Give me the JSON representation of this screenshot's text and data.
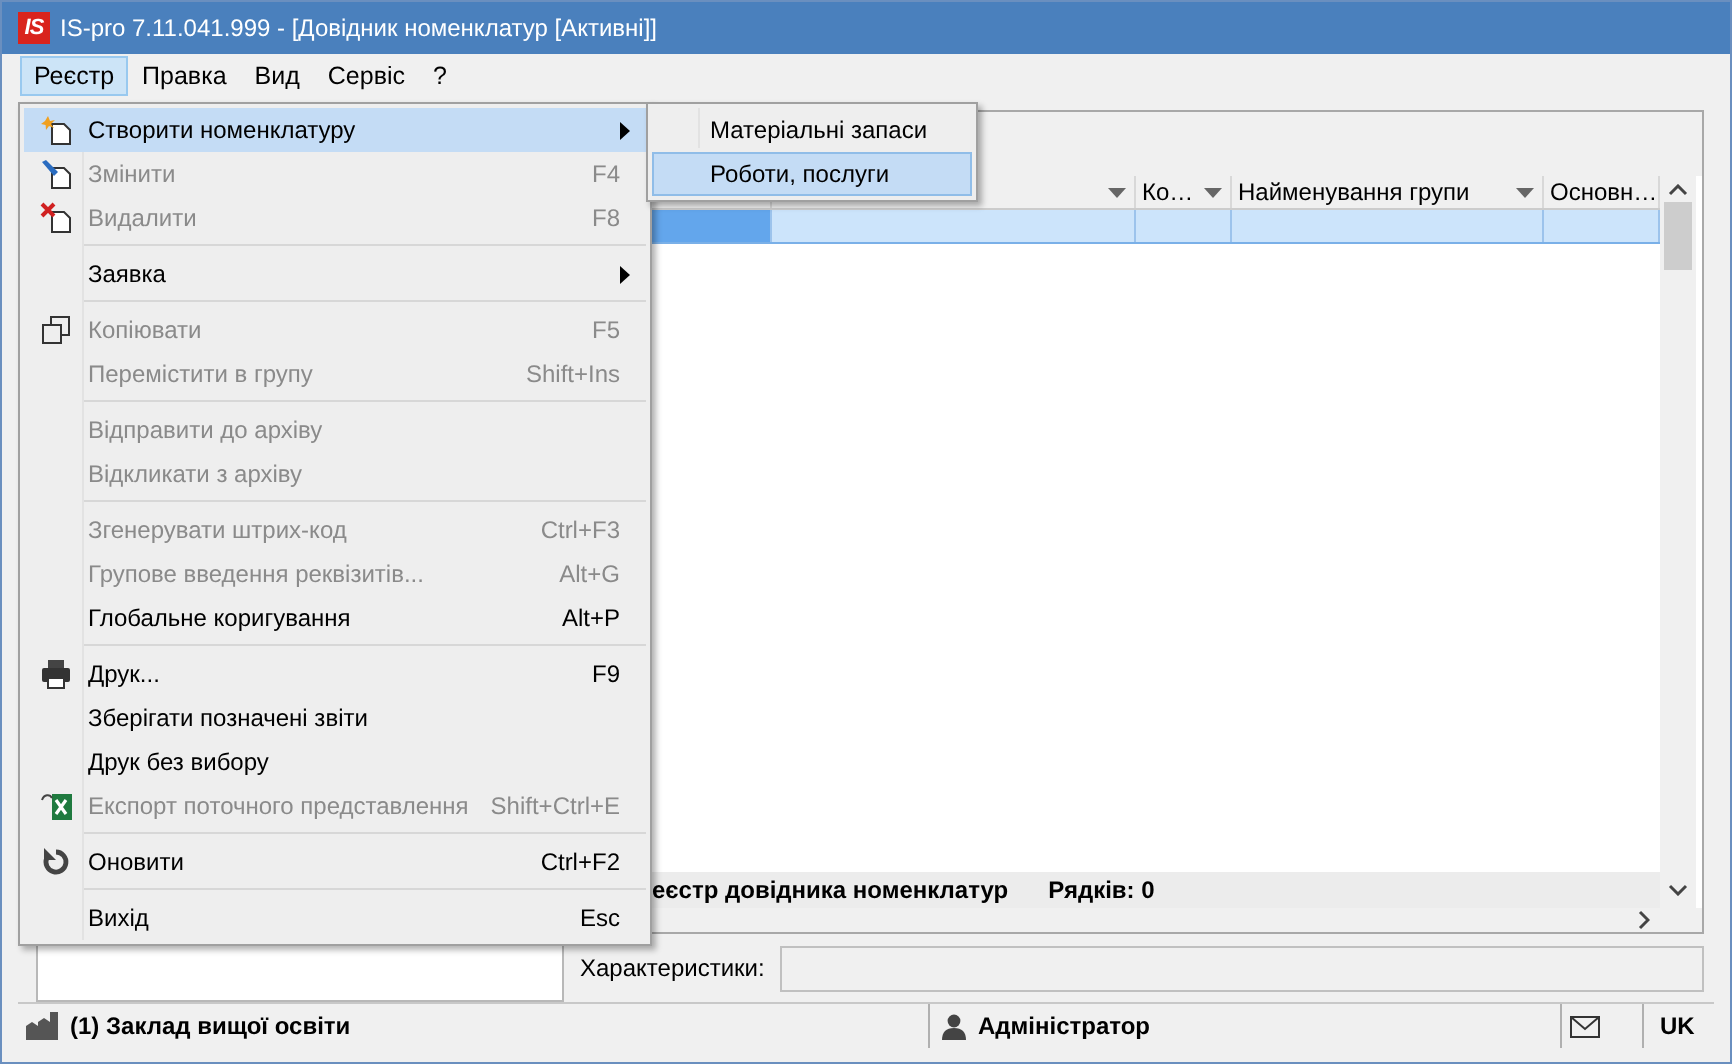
{
  "window": {
    "app_icon": "IS",
    "title": "IS-pro 7.11.041.999 - [Довідник номенклатур [Активні]]"
  },
  "menu_bar": [
    {
      "label": "Реєстр",
      "selected": true
    },
    {
      "label": "Правка",
      "selected": false
    },
    {
      "label": "Вид",
      "selected": false
    },
    {
      "label": "Сервіс",
      "selected": false
    },
    {
      "label": "?",
      "selected": false
    }
  ],
  "menu": {
    "items": [
      {
        "kind": "item",
        "label": "Створити номенклатуру",
        "disabled": false,
        "selected": true,
        "submenu": true
      },
      {
        "kind": "item",
        "label": "Змінити",
        "shortcut": "F4",
        "disabled": true,
        "selected": false,
        "submenu": false
      },
      {
        "kind": "item",
        "label": "Видалити",
        "shortcut": "F8",
        "disabled": true,
        "selected": false,
        "submenu": false
      },
      {
        "kind": "separator"
      },
      {
        "kind": "item",
        "label": "Заявка",
        "disabled": false,
        "selected": false,
        "submenu": true
      },
      {
        "kind": "separator"
      },
      {
        "kind": "item",
        "label": "Копіювати",
        "shortcut": "F5",
        "disabled": true,
        "selected": false,
        "submenu": false
      },
      {
        "kind": "item",
        "label": "Перемістити в групу",
        "shortcut": "Shift+Ins",
        "disabled": true,
        "selected": false,
        "submenu": false
      },
      {
        "kind": "separator"
      },
      {
        "kind": "item",
        "label": "Відправити до архіву",
        "disabled": true,
        "selected": false,
        "submenu": false
      },
      {
        "kind": "item",
        "label": "Відкликати з архіву",
        "disabled": true,
        "selected": false,
        "submenu": false
      },
      {
        "kind": "separator"
      },
      {
        "kind": "item",
        "label": "Згенерувати штрих-код",
        "shortcut": "Ctrl+F3",
        "disabled": true,
        "selected": false,
        "submenu": false
      },
      {
        "kind": "item",
        "label": "Групове введення реквізитів...",
        "shortcut": "Alt+G",
        "disabled": true,
        "selected": false,
        "submenu": false
      },
      {
        "kind": "item",
        "label": "Глобальне коригування",
        "shortcut": "Alt+P",
        "disabled": false,
        "selected": false,
        "submenu": false
      },
      {
        "kind": "separator"
      },
      {
        "kind": "item",
        "label": "Друк...",
        "shortcut": "F9",
        "disabled": false,
        "selected": false,
        "submenu": false
      },
      {
        "kind": "item",
        "label": "Зберігати позначені звіти",
        "disabled": false,
        "selected": false,
        "submenu": false
      },
      {
        "kind": "item",
        "label": "Друк без вибору",
        "disabled": false,
        "selected": false,
        "submenu": false
      },
      {
        "kind": "item",
        "label": "Експорт поточного представлення",
        "shortcut": "Shift+Ctrl+E",
        "disabled": true,
        "selected": false,
        "submenu": false
      },
      {
        "kind": "separator"
      },
      {
        "kind": "item",
        "label": "Оновити",
        "shortcut": "Ctrl+F2",
        "disabled": false,
        "selected": false,
        "submenu": false
      },
      {
        "kind": "separator"
      },
      {
        "kind": "item",
        "label": "Вихід",
        "shortcut": "Esc",
        "disabled": false,
        "selected": false,
        "submenu": false
      }
    ]
  },
  "submenu": {
    "items": [
      {
        "label": "Матеріальні запаси",
        "selected": false
      },
      {
        "label": "Роботи, послуги",
        "selected": true
      }
    ]
  },
  "grid": {
    "columns": [
      {
        "filter": true
      },
      {
        "label": "Ко…",
        "filter": true
      },
      {
        "label": "Найменування групи",
        "filter": true
      },
      {
        "label": "Основн…"
      }
    ],
    "rows": [
      {
        "selected": true
      }
    ],
    "footer": {
      "title": "еєстр довідника номенклатур",
      "count": "Рядків: 0"
    }
  },
  "characteristics": {
    "label": "Характеристики:"
  },
  "status_bar": {
    "organization": "(1) Заклад вищої освіти",
    "user": "Адміністратор",
    "language": "UK"
  }
}
